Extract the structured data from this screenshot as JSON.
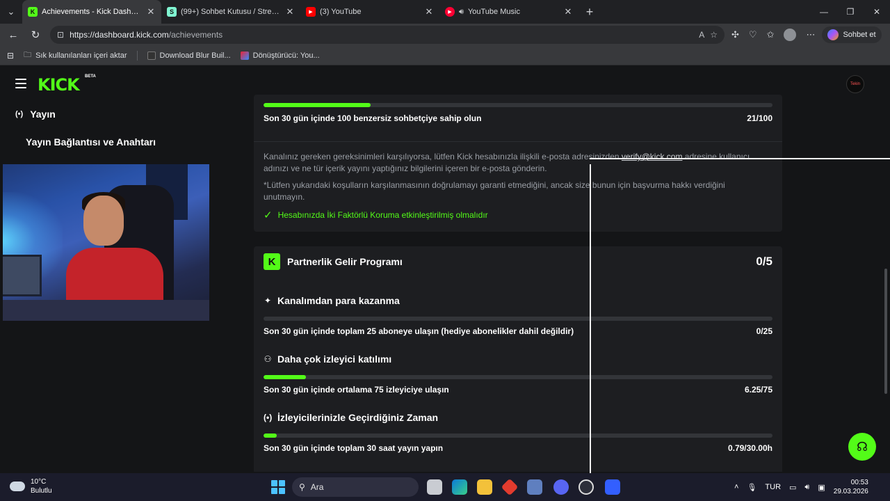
{
  "browser": {
    "tabs": [
      {
        "title": "Achievements - Kick Dashboard",
        "active": true,
        "favicon_color": "#53fc18"
      },
      {
        "title": "(99+) Sohbet Kutusu / Streamlabs",
        "active": false,
        "favicon_color": "#80f5d2"
      },
      {
        "title": "(3) YouTube",
        "active": false,
        "favicon_color": "#ff0000"
      },
      {
        "title": "YouTube Music",
        "active": false,
        "favicon_color": "#ff0033"
      }
    ],
    "url_host": "https://dashboard.kick.com",
    "url_path": "/achievements",
    "copilot_label": "Sohbet et",
    "bookmarks": [
      {
        "label": "Sık kullanılanları içeri aktar"
      },
      {
        "label": "Download Blur Buil..."
      },
      {
        "label": "Dönüştürücü: You..."
      }
    ]
  },
  "kick": {
    "logo": "KICK",
    "beta": "BETA",
    "avatar_text": "Tekin"
  },
  "sidebar": {
    "items": [
      {
        "label": "Yayın",
        "icon": "broadcast-icon"
      },
      {
        "label": "Yayın Bağlantısı ve Anahtarı"
      }
    ]
  },
  "top_card": {
    "progress_fraction": 0.21,
    "requirement": "Son 30 gün içinde 100 benzersiz sohbetçiye sahip olun",
    "value": "21/100",
    "info_1_pre": "Kanalınız gereken gereksinimleri karşılıyorsa, lütfen Kick hesabınızla ilişkili e-posta adresinizden ",
    "info_email": "verify@kick.com",
    "info_1_post": " adresine kullanıcı adınızı ve ne tür içerik yayını yaptığınız bilgilerini içeren bir e-posta gönderin.",
    "info_2": "*Lütfen yukarıdaki koşulların karşılanmasının doğrulamayı garanti etmediğini, ancak size bunun için başvurma hakkı verdiğini unutmayın.",
    "two_factor": "Hesabınızda İki Faktörlü Koruma etkinleştirilmiş olmalıdır"
  },
  "program": {
    "badge": "K",
    "title": "Partnerlik Gelir Programı",
    "count": "0/5",
    "sections": [
      {
        "title": "Kanalımdan para kazanma",
        "icon": "sparkle-icon",
        "progress_fraction": 0.0,
        "requirement": "Son 30 gün içinde toplam 25 aboneye ulaşın (hediye abonelikler dahil değildir)",
        "value": "0/25"
      },
      {
        "title": "Daha çok izleyici katılımı",
        "icon": "viewers-icon",
        "progress_fraction": 0.083,
        "requirement": "Son 30 gün içinde ortalama 75 izleyiciye ulaşın",
        "value": "6.25/75"
      },
      {
        "title": "İzleyicilerinizle Geçirdiğiniz Zaman",
        "icon": "broadcast-icon",
        "progress_fraction": 0.026,
        "requirement": "Son 30 gün içinde toplam 30 saat yayın yapın",
        "value": "0.79/30.00h"
      }
    ]
  },
  "colors": {
    "accent": "#53fc18",
    "background": "#141517",
    "card": "#1d1e21"
  },
  "taskbar": {
    "temp": "10°C",
    "weather": "Bulutlu",
    "search": "Ara",
    "lang": "TUR",
    "time": "00:53",
    "date": "29.03.2026",
    "discord_badge": "9+"
  }
}
